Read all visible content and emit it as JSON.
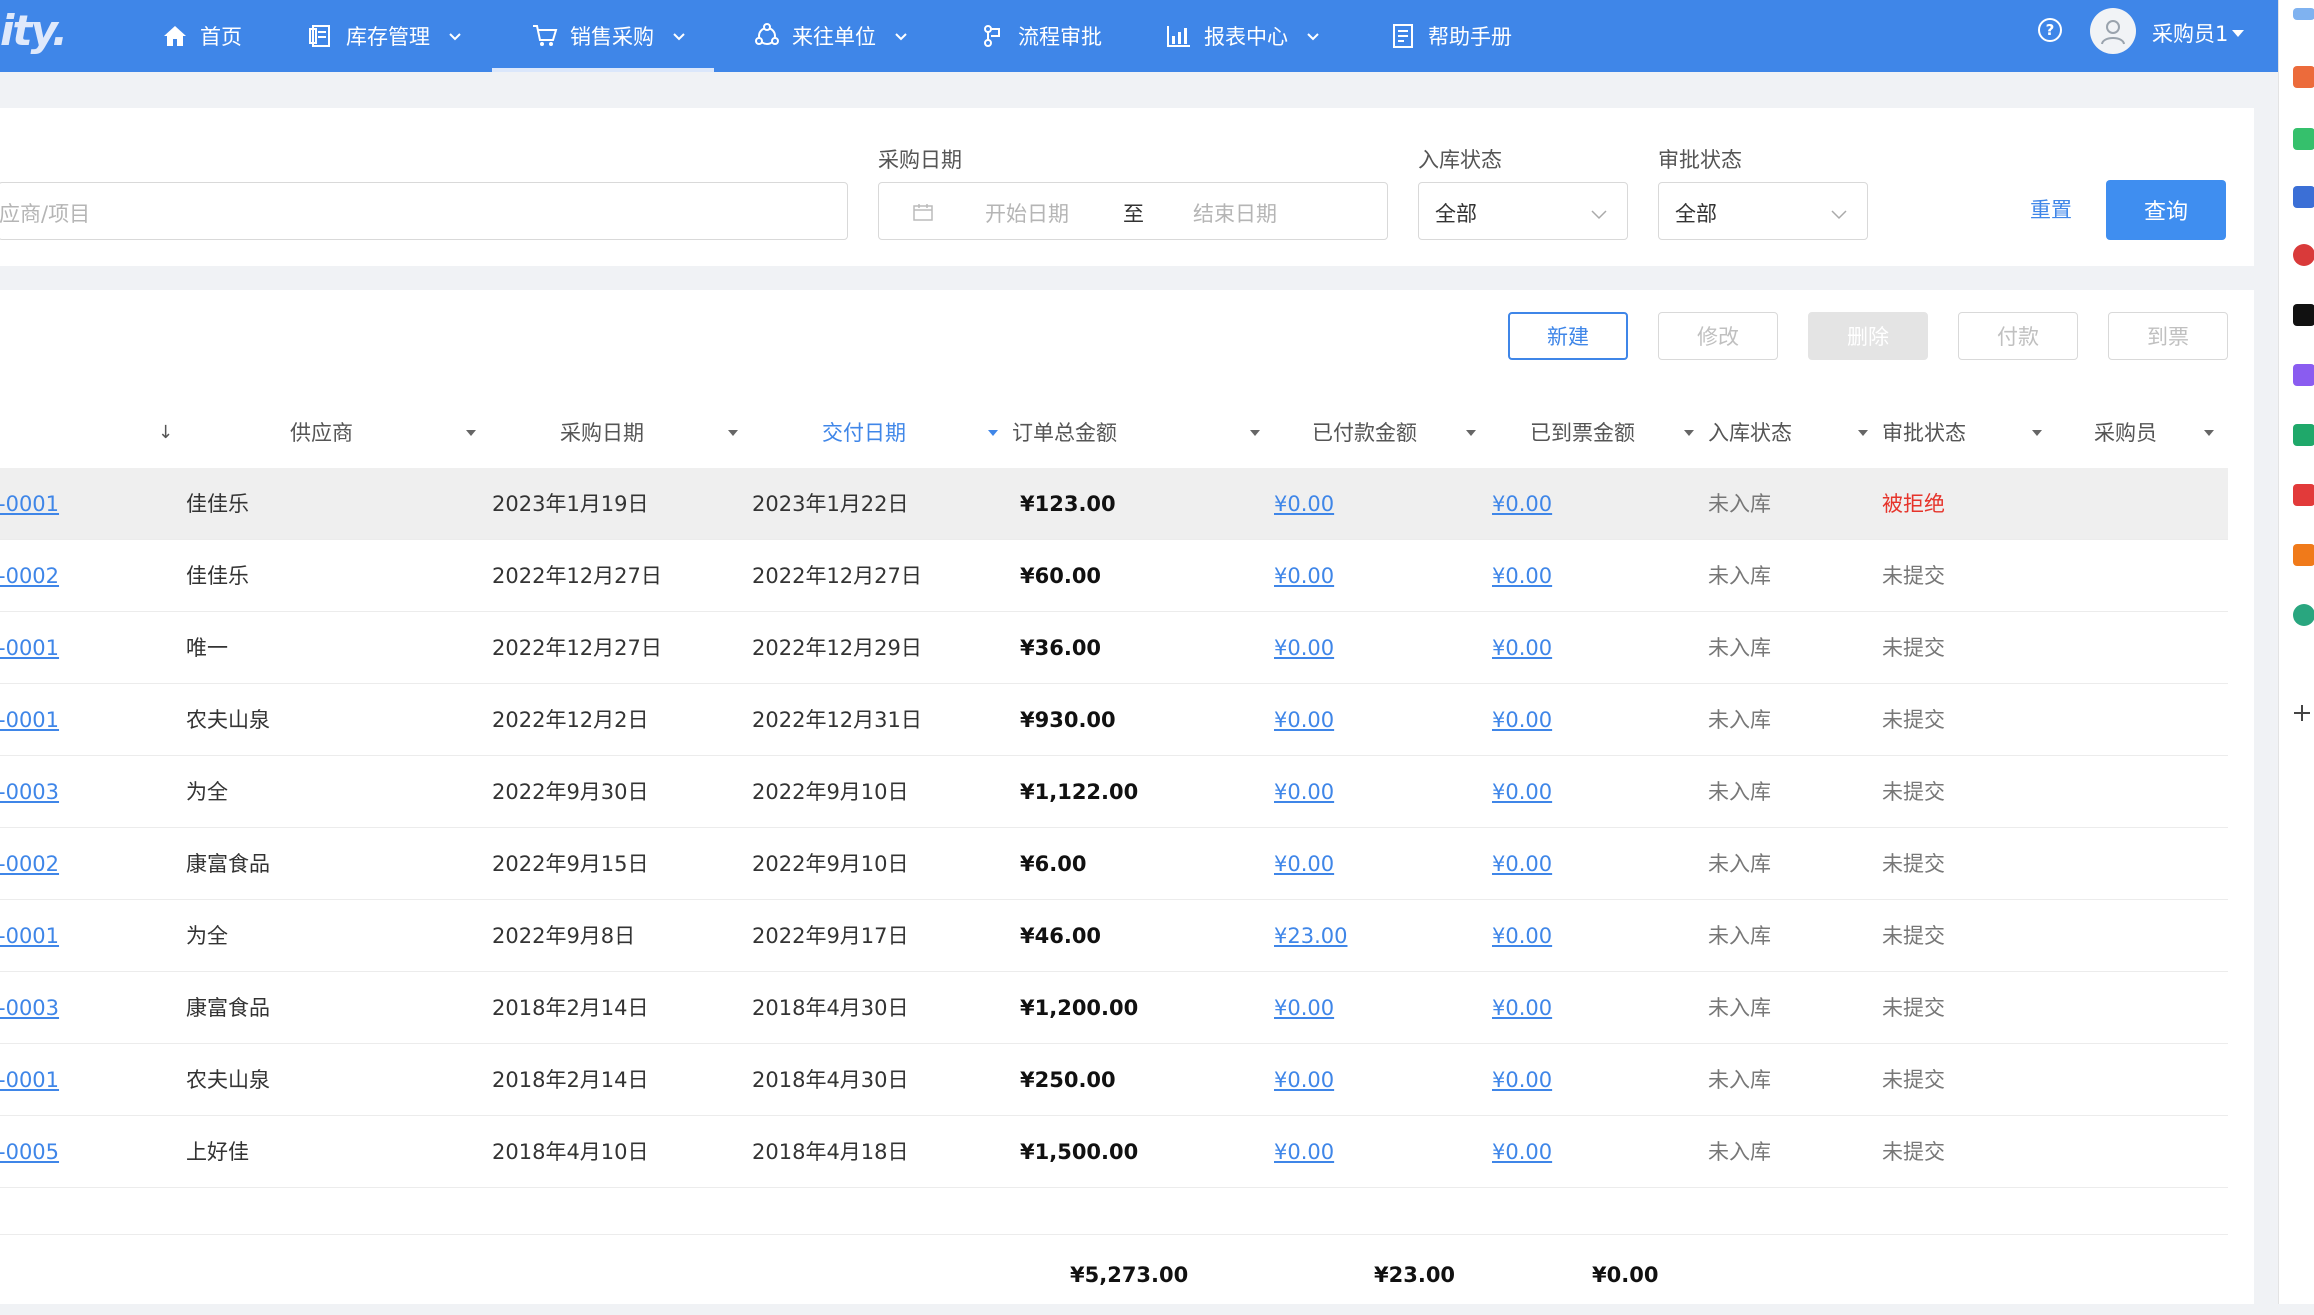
{
  "nav": {
    "logo_text": "ity.",
    "items": [
      {
        "label": "首页",
        "icon": "home-icon"
      },
      {
        "label": "库存管理",
        "icon": "inventory-icon"
      },
      {
        "label": "销售采购",
        "icon": "cart-icon"
      },
      {
        "label": "来往单位",
        "icon": "partners-icon"
      },
      {
        "label": "流程审批",
        "icon": "workflow-icon"
      },
      {
        "label": "报表中心",
        "icon": "chart-icon"
      },
      {
        "label": "帮助手册",
        "icon": "manual-icon"
      }
    ],
    "active_index": 2,
    "help_glyph": "?",
    "user": "采购员1"
  },
  "filter": {
    "search_placeholder": "应商/项目",
    "date_label": "采购日期",
    "start_placeholder": "开始日期",
    "to_text": "至",
    "end_placeholder": "结束日期",
    "stock_label": "入库状态",
    "stock_value": "全部",
    "approval_label": "审批状态",
    "approval_value": "全部",
    "reset_label": "重置",
    "query_label": "查询"
  },
  "actions": {
    "new": "新建",
    "edit": "修改",
    "delete": "删除",
    "pay": "付款",
    "invoice": "到票"
  },
  "table": {
    "sort_glyph": "↓",
    "headers": {
      "supplier": "供应商",
      "purchase_date": "采购日期",
      "delivery_date": "交付日期",
      "total": "订单总金额",
      "paid": "已付款金额",
      "invoiced": "已到票金额",
      "stock": "入库状态",
      "approval": "审批状态",
      "buyer": "采购员"
    },
    "rows": [
      {
        "no": "-0001",
        "supplier": "佳佳乐",
        "purchase_date": "2023年1月19日",
        "delivery_date": "2023年1月22日",
        "total": "¥123.00",
        "paid": "¥0.00",
        "invoiced": "¥0.00",
        "stock": "未入库",
        "approval": "被拒绝"
      },
      {
        "no": "-0002",
        "supplier": "佳佳乐",
        "purchase_date": "2022年12月27日",
        "delivery_date": "2022年12月27日",
        "total": "¥60.00",
        "paid": "¥0.00",
        "invoiced": "¥0.00",
        "stock": "未入库",
        "approval": "未提交"
      },
      {
        "no": "-0001",
        "supplier": "唯一",
        "purchase_date": "2022年12月27日",
        "delivery_date": "2022年12月29日",
        "total": "¥36.00",
        "paid": "¥0.00",
        "invoiced": "¥0.00",
        "stock": "未入库",
        "approval": "未提交"
      },
      {
        "no": "-0001",
        "supplier": "农夫山泉",
        "purchase_date": "2022年12月2日",
        "delivery_date": "2022年12月31日",
        "total": "¥930.00",
        "paid": "¥0.00",
        "invoiced": "¥0.00",
        "stock": "未入库",
        "approval": "未提交"
      },
      {
        "no": "-0003",
        "supplier": "为全",
        "purchase_date": "2022年9月30日",
        "delivery_date": "2022年9月10日",
        "total": "¥1,122.00",
        "paid": "¥0.00",
        "invoiced": "¥0.00",
        "stock": "未入库",
        "approval": "未提交"
      },
      {
        "no": "-0002",
        "supplier": "康富食品",
        "purchase_date": "2022年9月15日",
        "delivery_date": "2022年9月10日",
        "total": "¥6.00",
        "paid": "¥0.00",
        "invoiced": "¥0.00",
        "stock": "未入库",
        "approval": "未提交"
      },
      {
        "no": "-0001",
        "supplier": "为全",
        "purchase_date": "2022年9月8日",
        "delivery_date": "2022年9月17日",
        "total": "¥46.00",
        "paid": "¥23.00",
        "invoiced": "¥0.00",
        "stock": "未入库",
        "approval": "未提交"
      },
      {
        "no": "-0003",
        "supplier": "康富食品",
        "purchase_date": "2018年2月14日",
        "delivery_date": "2018年4月30日",
        "total": "¥1,200.00",
        "paid": "¥0.00",
        "invoiced": "¥0.00",
        "stock": "未入库",
        "approval": "未提交"
      },
      {
        "no": "-0001",
        "supplier": "农夫山泉",
        "purchase_date": "2018年2月14日",
        "delivery_date": "2018年4月30日",
        "total": "¥250.00",
        "paid": "¥0.00",
        "invoiced": "¥0.00",
        "stock": "未入库",
        "approval": "未提交"
      },
      {
        "no": "-0005",
        "supplier": "上好佳",
        "purchase_date": "2018年4月10日",
        "delivery_date": "2018年4月18日",
        "total": "¥1,500.00",
        "paid": "¥0.00",
        "invoiced": "¥0.00",
        "stock": "未入库",
        "approval": "未提交"
      }
    ],
    "totals": {
      "total": "¥5,273.00",
      "paid": "¥23.00",
      "invoiced": "¥0.00"
    }
  },
  "colors": {
    "primary": "#3f86e8",
    "rejected": "#e6332a",
    "nav_bg": "#3f86e8"
  }
}
